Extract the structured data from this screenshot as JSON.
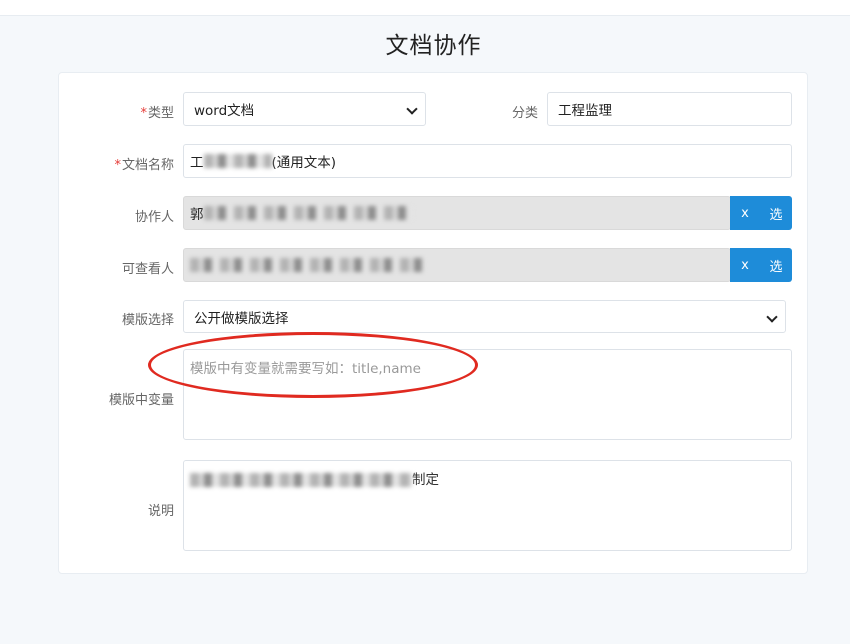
{
  "page": {
    "title": "文档协作"
  },
  "form": {
    "type": {
      "label": "类型",
      "required_mark": "*",
      "value": "word文档"
    },
    "category": {
      "label": "分类",
      "value": "工程监理"
    },
    "doc_name": {
      "label": "文档名称",
      "required_mark": "*",
      "value_prefix": "工",
      "value_suffix": "(通用文本)"
    },
    "collaborator": {
      "label": "协作人",
      "value_prefix": "郭",
      "clear_button": "x",
      "select_button": "选"
    },
    "viewer": {
      "label": "可查看人",
      "clear_button": "x",
      "select_button": "选"
    },
    "template": {
      "label": "模版选择",
      "value": "公开做模版选择"
    },
    "template_vars": {
      "label": "模版中变量",
      "placeholder": "模版中有变量就需要写如：title,name"
    },
    "description": {
      "label": "说明",
      "value_suffix": "制定"
    }
  },
  "annotation": {
    "color": "#e02a20"
  },
  "colors": {
    "accent": "#1e8cd9",
    "required": "#e53935",
    "disabled_bg": "#e4e4e4"
  }
}
